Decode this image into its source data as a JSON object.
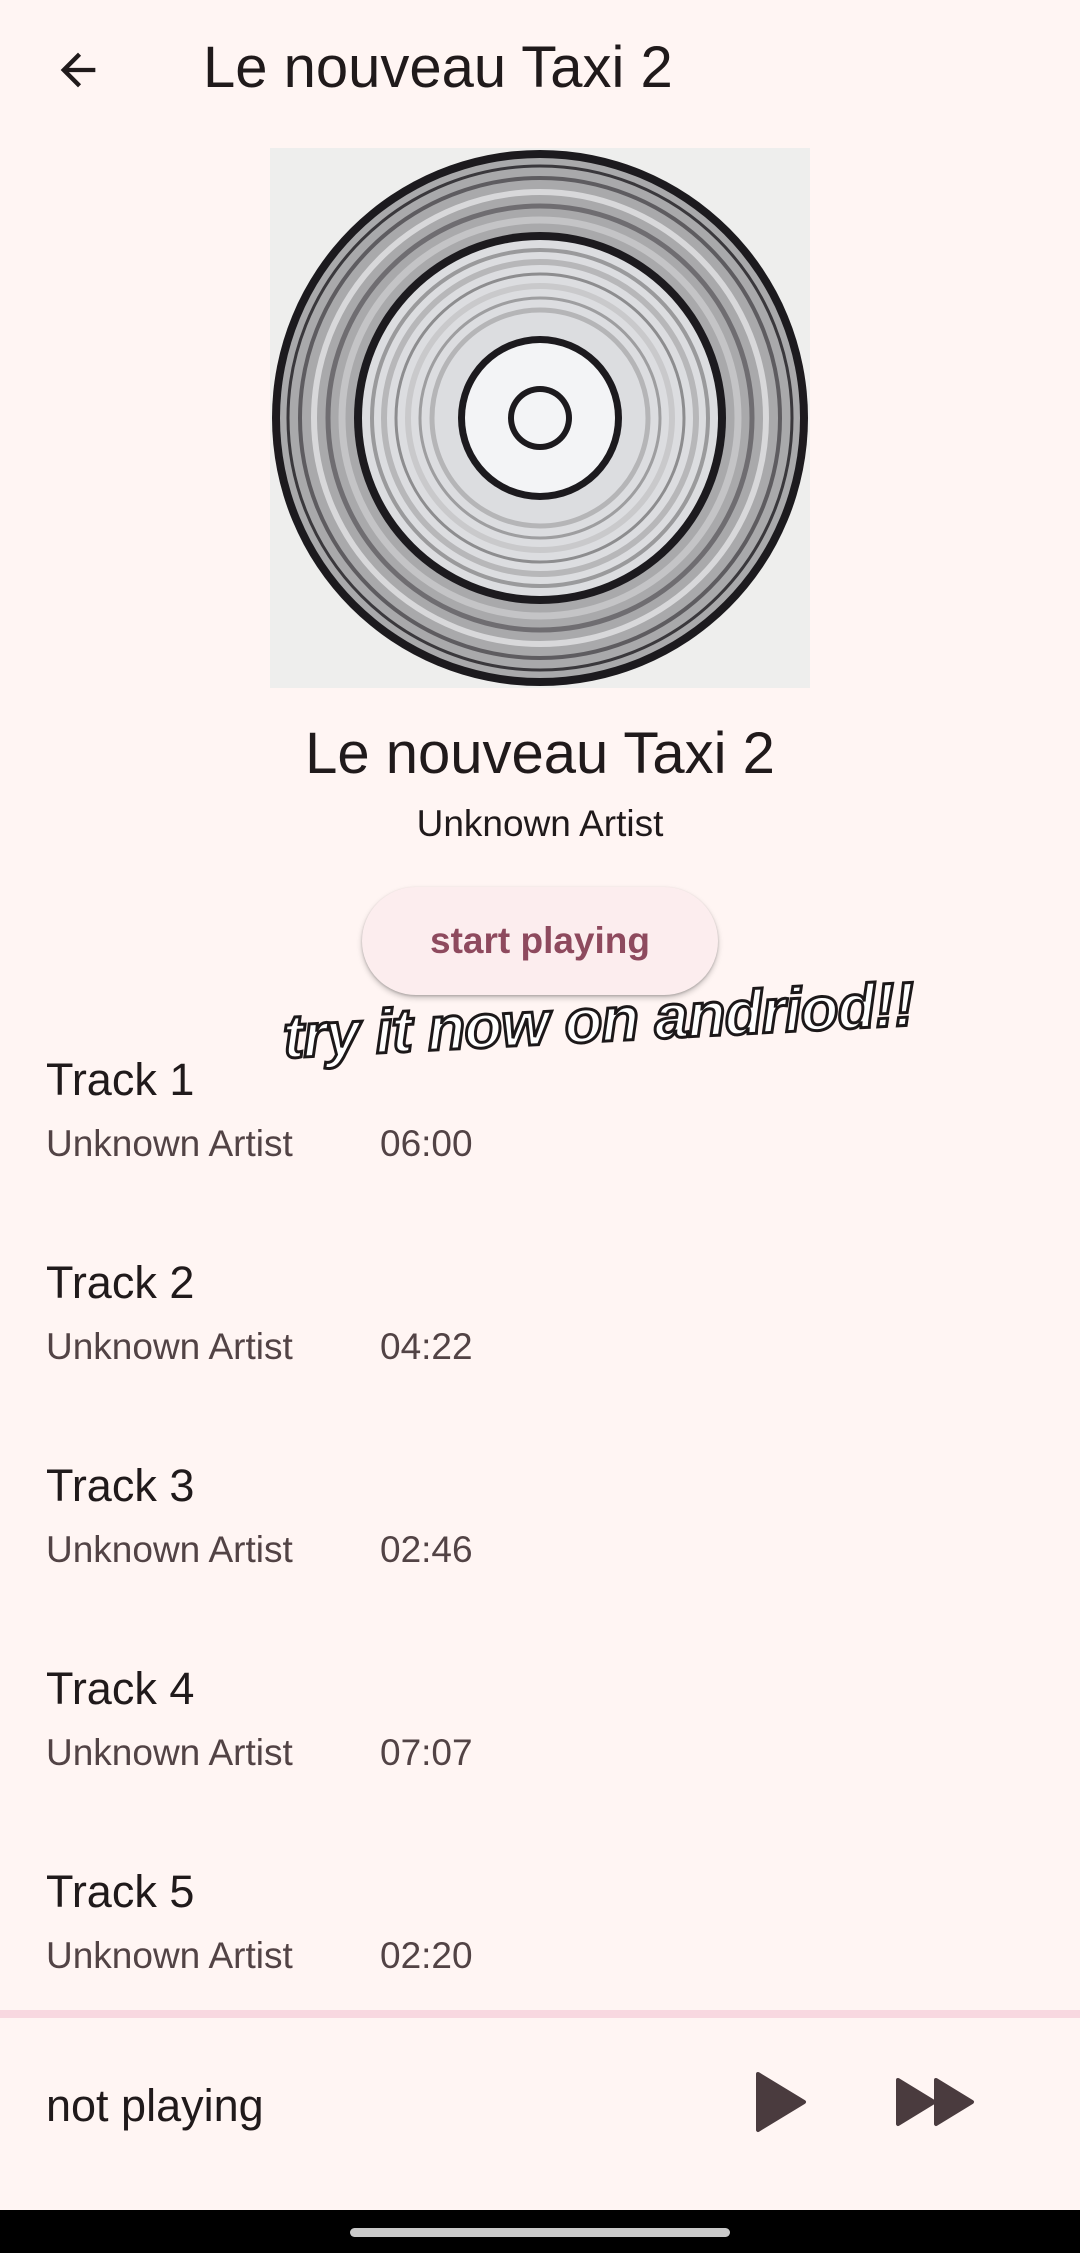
{
  "header": {
    "title": "Le nouveau Taxi 2",
    "back_icon": "arrow-back-icon"
  },
  "album": {
    "cover_icon": "vinyl-record-artwork",
    "title": "Le nouveau Taxi 2",
    "artist": "Unknown Artist",
    "start_label": "start playing"
  },
  "promo": {
    "text": "try it now on andriod!!"
  },
  "tracks": [
    {
      "title": "Track 1",
      "artist": "Unknown Artist",
      "duration": "06:00"
    },
    {
      "title": "Track 2",
      "artist": "Unknown Artist",
      "duration": "04:22"
    },
    {
      "title": "Track 3",
      "artist": "Unknown Artist",
      "duration": "02:46"
    },
    {
      "title": "Track 4",
      "artist": "Unknown Artist",
      "duration": "07:07"
    },
    {
      "title": "Track 5",
      "artist": "Unknown Artist",
      "duration": "02:20"
    }
  ],
  "player": {
    "status": "not playing",
    "play_icon": "play-icon",
    "next_icon": "fast-forward-icon"
  },
  "colors": {
    "background": "#fff5f3",
    "accent": "#8e4a5e",
    "button_bg": "#fcedee",
    "divider": "#f8d8e0",
    "icon": "#4a3b3e"
  }
}
